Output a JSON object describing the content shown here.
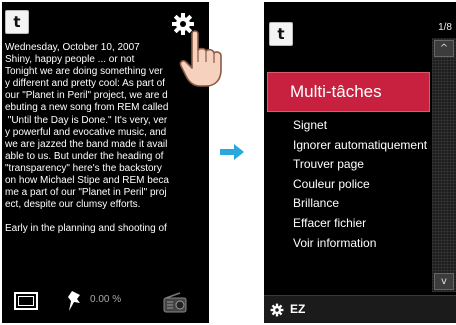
{
  "left_screen": {
    "back_label": "t",
    "text_lines": [
      "Wednesday, October 10, 2007",
      "Shiny, happy people ... or not",
      "Tonight we are doing something ver",
      "y different and pretty cool: As part of",
      "our \"Planet in Peril\" project, we are d",
      "ebuting a new song from REM called",
      " \"Until the Day is Done.\" It's very, ver",
      "y powerful and evocative music, and",
      "we are jazzed the band made it avail",
      "able to us. But under the heading of",
      "\"transparency\" here's the backstory",
      "on how Michael Stipe and REM beca",
      "me a part of our \"Planet in Peril\" proj",
      "ect, despite our clumsy efforts.",
      "",
      "Early in the planning and shooting of"
    ],
    "progress_text": "0.00 %",
    "icons": {
      "back": "back-arrow-icon",
      "settings": "gear-icon",
      "page": "page-view-icon",
      "bookmark": "pin-icon",
      "radio": "radio-icon",
      "hand": "tap-hand-icon"
    }
  },
  "arrow": {
    "icon": "right-arrow-icon",
    "color": "#29a8e0"
  },
  "right_screen": {
    "back_label": "t",
    "page_count": "1/8",
    "menu_title": "Multi-tâches",
    "menu_items": [
      "Signet",
      "Ignorer automatiquement",
      "Trouver page",
      "Couleur police",
      "Brillance",
      "Effacer fichier",
      "Voir information"
    ],
    "scroll_up": "^",
    "scroll_down": "v",
    "bottom_label": "EZ",
    "accent_color": "#c8213f"
  }
}
